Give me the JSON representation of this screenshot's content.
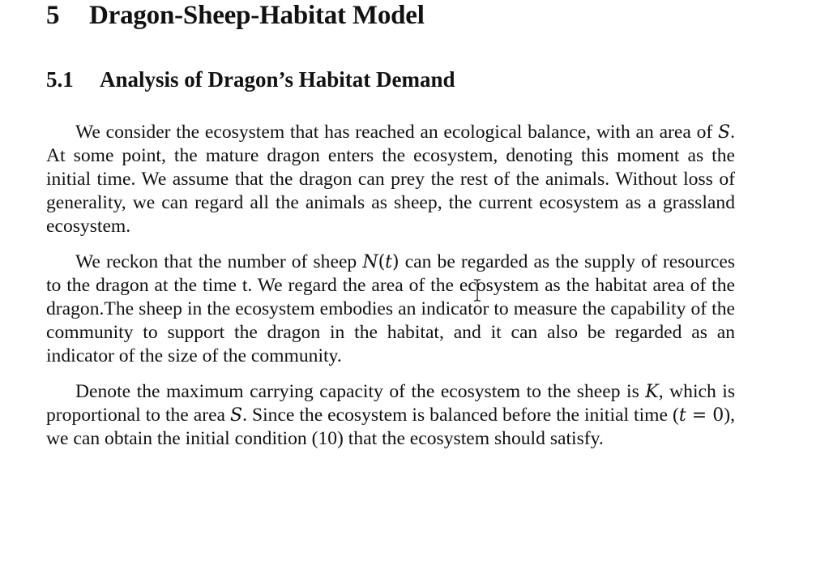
{
  "section": {
    "number": "5",
    "title": "Dragon-Sheep-Habitat Model"
  },
  "subsection": {
    "number": "5.1",
    "title": "Analysis of Dragon’s Habitat Demand"
  },
  "paragraph1": {
    "s1_before": "We consider the ecosystem that has reached an ecological balance, with an area of ",
    "s1_var": "S",
    "s1_after": ". At some point, the mature dragon enters the ecosystem, denoting this moment as the initial time. We assume that the dragon can prey the rest of the animals. Without loss of generality, we can regard all the animals as sheep, the current ecosystem as a grassland ecosystem."
  },
  "paragraph2": {
    "before": "We reckon that the number of sheep ",
    "func": "N",
    "arg_open": "(",
    "arg_var": "t",
    "arg_close": ")",
    "after": " can be regarded as the supply of resources to the dragon at the time t. We regard the area of the ecosystem as the habitat area of the dragon.The sheep in the ecosystem embodies an indicator to measure the capability of the community to support the dragon in the habitat, and it can also be regarded as an indicator of the size of the community."
  },
  "paragraph3": {
    "before": "Denote the maximum carrying capacity of the ecosystem to the sheep is ",
    "var_k": "K",
    "mid1": ", which is proportional to the area ",
    "var_s": "S",
    "mid2": ". Since the ecosystem is balanced before the initial time (",
    "eq_var": "t",
    "eq_sign": " = ",
    "eq_val": "0",
    "after": "), we can obtain the initial condition (10) that the ecosystem should satisfy."
  },
  "icons": {
    "cursor": "text-cursor-icon"
  }
}
